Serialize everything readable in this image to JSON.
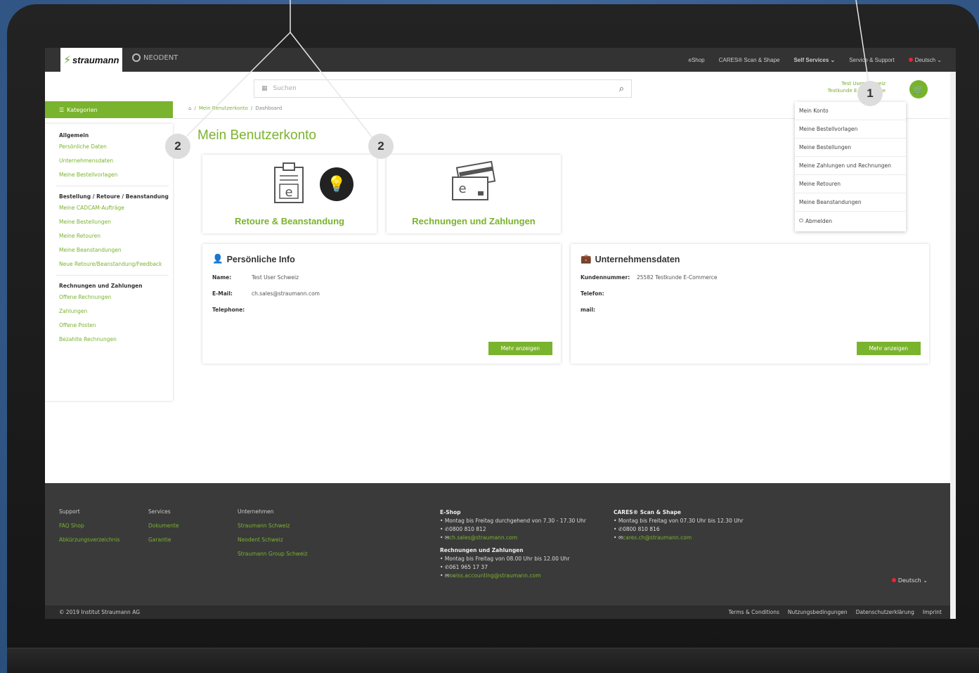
{
  "topnav": {
    "logo": "straumann",
    "neodent": "NEODENT",
    "menu": [
      "eShop",
      "CARES® Scan & Shape",
      "Self Services",
      "Service & Support",
      "Deutsch"
    ]
  },
  "search": {
    "placeholder": "Suchen"
  },
  "user": {
    "line1": "Test User Schweiz",
    "line2": "Testkunde E-Commerce"
  },
  "categories_label": "Kategorien",
  "breadcrumb": [
    "Mein Benutzerkonto",
    "Dashboard"
  ],
  "sidebar": {
    "groups": [
      {
        "heading": "Allgemein",
        "items": [
          "Persönliche Daten",
          "Unternehmensdaten",
          "Meine Bestellvorlagen"
        ]
      },
      {
        "heading": "Bestellung / Retoure / Beanstandung",
        "items": [
          "Meine CADCAM-Aufträge",
          "Meine Bestellungen",
          "Meine Retouren",
          "Meine Beanstandungen",
          "Neue Retoure/Beanstandung/Feedback"
        ]
      },
      {
        "heading": "Rechnungen und Zahlungen",
        "items": [
          "Offene Rechnungen",
          "Zahlungen",
          "Offene Posten",
          "Bezahlte Rechnungen"
        ]
      }
    ]
  },
  "page_title": "Mein Benutzerkonto",
  "tiles": [
    {
      "label": "Retoure & Beanstandung"
    },
    {
      "label": "Rechnungen und Zahlungen"
    }
  ],
  "personal": {
    "title": "Persönliche Info",
    "rows": [
      {
        "k": "Name:",
        "v": "Test User Schweiz"
      },
      {
        "k": "E-Mail:",
        "v": "ch.sales@straumann.com"
      },
      {
        "k": "Telephone:",
        "v": ""
      }
    ],
    "button": "Mehr anzeigen"
  },
  "company": {
    "title": "Unternehmensdaten",
    "rows": [
      {
        "k": "Kundennummer:",
        "v": "25582 Testkunde E-Commerce"
      },
      {
        "k": "Telefon:",
        "v": ""
      },
      {
        "k": "mail:",
        "v": ""
      }
    ],
    "button": "Mehr anzeigen"
  },
  "dropdown": [
    "Mein Konto",
    "Meine Bestellvorlagen",
    "Meine Bestellungen",
    "Meine Zahlungen und Rechnungen",
    "Meine Retouren",
    "Meine Beanstandungen",
    "Abmelden"
  ],
  "footer": {
    "cols": [
      {
        "heading": "Support",
        "links": [
          "FAQ Shop",
          "Abkürzungsverzeichnis"
        ]
      },
      {
        "heading": "Services",
        "links": [
          "Dokumente",
          "Garantie"
        ]
      },
      {
        "heading": "Unternehmen",
        "links": [
          "Straumann Schweiz",
          "Neodent Schweiz",
          "Straumann Group Schweiz"
        ]
      }
    ],
    "eshop": {
      "heading": "E-Shop",
      "hours": "Montag bis Freitag durchgehend von 7.30 - 17.30 Uhr",
      "phone": "0800 810 812",
      "email": "ch.sales@straumann.com"
    },
    "billing": {
      "heading": "Rechnungen und Zahlungen",
      "hours": "Montag bis Freitag von 08.00 Uhr bis 12.00 Uhr",
      "phone": "061 965 17 37",
      "email": "swiss.accounting@straumann.com"
    },
    "cares": {
      "heading": "CARES® Scan & Shape",
      "hours": "Montag bis Freitag von 07.30 Uhr bis 12.30 Uhr",
      "phone": "0800 810 816",
      "email": "cares.ch@straumann.com"
    },
    "language": "Deutsch",
    "copyright": "© 2019 Institut Straumann AG",
    "legal": [
      "Terms & Conditions",
      "Nutzungsbedingungen",
      "Datenschutzerklärung",
      "Imprint"
    ]
  },
  "callouts": {
    "one": "1",
    "two": "2"
  },
  "colors": {
    "accent": "#7ab32e",
    "dark": "#333333"
  }
}
